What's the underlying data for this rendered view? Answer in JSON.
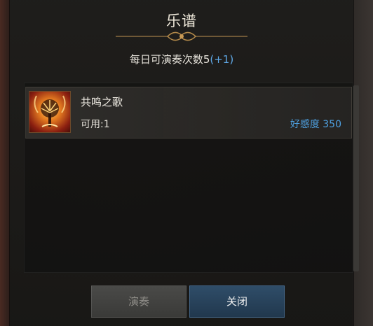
{
  "dialog": {
    "title": "乐谱",
    "daily_label": "每日可演奏次数5",
    "daily_bonus": "(+1)"
  },
  "items": [
    {
      "name": "共鸣之歌",
      "available": "可用:1",
      "favor": "好感度 350",
      "icon": "golden-tree-icon"
    }
  ],
  "buttons": {
    "play": "演奏",
    "close": "关闭"
  },
  "colors": {
    "accent_blue": "#4ea0e0",
    "close_button": "#2f4d68",
    "disabled_button": "#4a4a48"
  }
}
